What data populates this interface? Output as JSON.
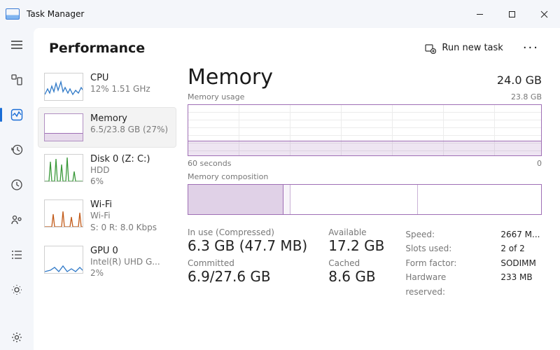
{
  "window": {
    "title": "Task Manager"
  },
  "topbar": {
    "heading": "Performance",
    "run_task": "Run new task"
  },
  "list": {
    "cpu": {
      "name": "CPU",
      "sub": "12%  1.51 GHz"
    },
    "mem": {
      "name": "Memory",
      "sub": "6.5/23.8 GB (27%)"
    },
    "disk": {
      "name": "Disk 0 (Z: C:)",
      "sub1": "HDD",
      "sub2": "6%"
    },
    "wifi": {
      "name": "Wi-Fi",
      "sub1": "Wi-Fi",
      "sub2": "S: 0  R: 8.0 Kbps"
    },
    "gpu": {
      "name": "GPU 0",
      "sub1": "Intel(R) UHD G...",
      "sub2": "2%"
    }
  },
  "main": {
    "title": "Memory",
    "capacity": "24.0 GB",
    "usage_label": "Memory usage",
    "usage_max": "23.8 GB",
    "axis_left": "60 seconds",
    "axis_right": "0",
    "comp_label": "Memory composition",
    "stats": {
      "inuse_label": "In use (Compressed)",
      "inuse_value": "6.3 GB (47.7 MB)",
      "committed_label": "Committed",
      "committed_value": "6.9/27.6 GB",
      "available_label": "Available",
      "available_value": "17.2 GB",
      "cached_label": "Cached",
      "cached_value": "8.6 GB",
      "speed_k": "Speed:",
      "speed_v": "2667 M...",
      "slots_k": "Slots used:",
      "slots_v": "2 of 2",
      "form_k": "Form factor:",
      "form_v": "SODIMM",
      "hw_k": "Hardware reserved:",
      "hw_v": "233 MB"
    }
  },
  "chart_data": {
    "type": "line",
    "title": "Memory usage",
    "xlabel": "60 seconds → 0",
    "ylabel": "GB",
    "ylim": [
      0,
      23.8
    ],
    "series": [
      {
        "name": "In use",
        "values": [
          6.5,
          6.5,
          6.5,
          6.5,
          6.5,
          6.5,
          6.5,
          6.5,
          6.5,
          6.5,
          6.5,
          6.5
        ]
      }
    ],
    "composition": {
      "in_use_gb": 6.3,
      "modified_gb": 0.3,
      "standby_gb": 8.6,
      "free_gb": 8.6,
      "total_gb": 23.8
    }
  }
}
